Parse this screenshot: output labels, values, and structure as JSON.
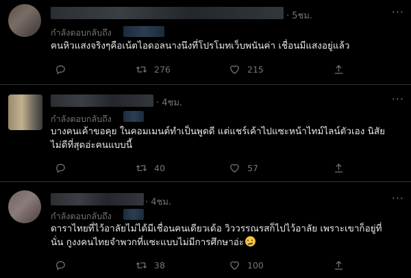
{
  "replying_to_label": "กำลังตอบกลับถึง",
  "tweets": [
    {
      "time": "· 5ชม.",
      "text": "คนหิวแสงจริงๆคือเน้ตไอดอลนางนึงที่โปรโมทเว็บพนันค่า เชื่อนมีแสงอยู่แล้ว",
      "text2": "",
      "retweets": "276",
      "likes": "215"
    },
    {
      "time": "· 4ชม.",
      "text": "บางคนเค้าขอคุย ในคอมเมนต์ทำเป็นพูดดี แต่แชร์เค้าไปแซะหน้าไทม์ไลน์ตัวเอง นิสัย",
      "text2": "ไม่ดีที่สุดอ่ะคนแบบนี้",
      "retweets": "40",
      "likes": "57"
    },
    {
      "time": "· 4ชม.",
      "text": "ดาราไทยที่ไว้อาลัยไม่ได้มีเชื่อนคนเดียวเด้อ วิววรรณรสก็ไปไว้อาลัย เพราะเขาก็อยู่ที่",
      "text2": "นั่น กูงงคนไทยจำพวกที่แซะแบบไม่มีการศึกษาอ่ะ",
      "retweets": "38",
      "likes": "100"
    }
  ],
  "icons": {
    "reply": "reply-icon",
    "retweet": "retweet-icon",
    "like": "heart-icon",
    "share": "share-icon",
    "more": "more-icon",
    "emoji": "disappointed-face-emoji"
  },
  "colors": {
    "background": "#000000",
    "text": "#e7e9ea",
    "secondary": "#71767b",
    "divider": "#2f3336"
  }
}
